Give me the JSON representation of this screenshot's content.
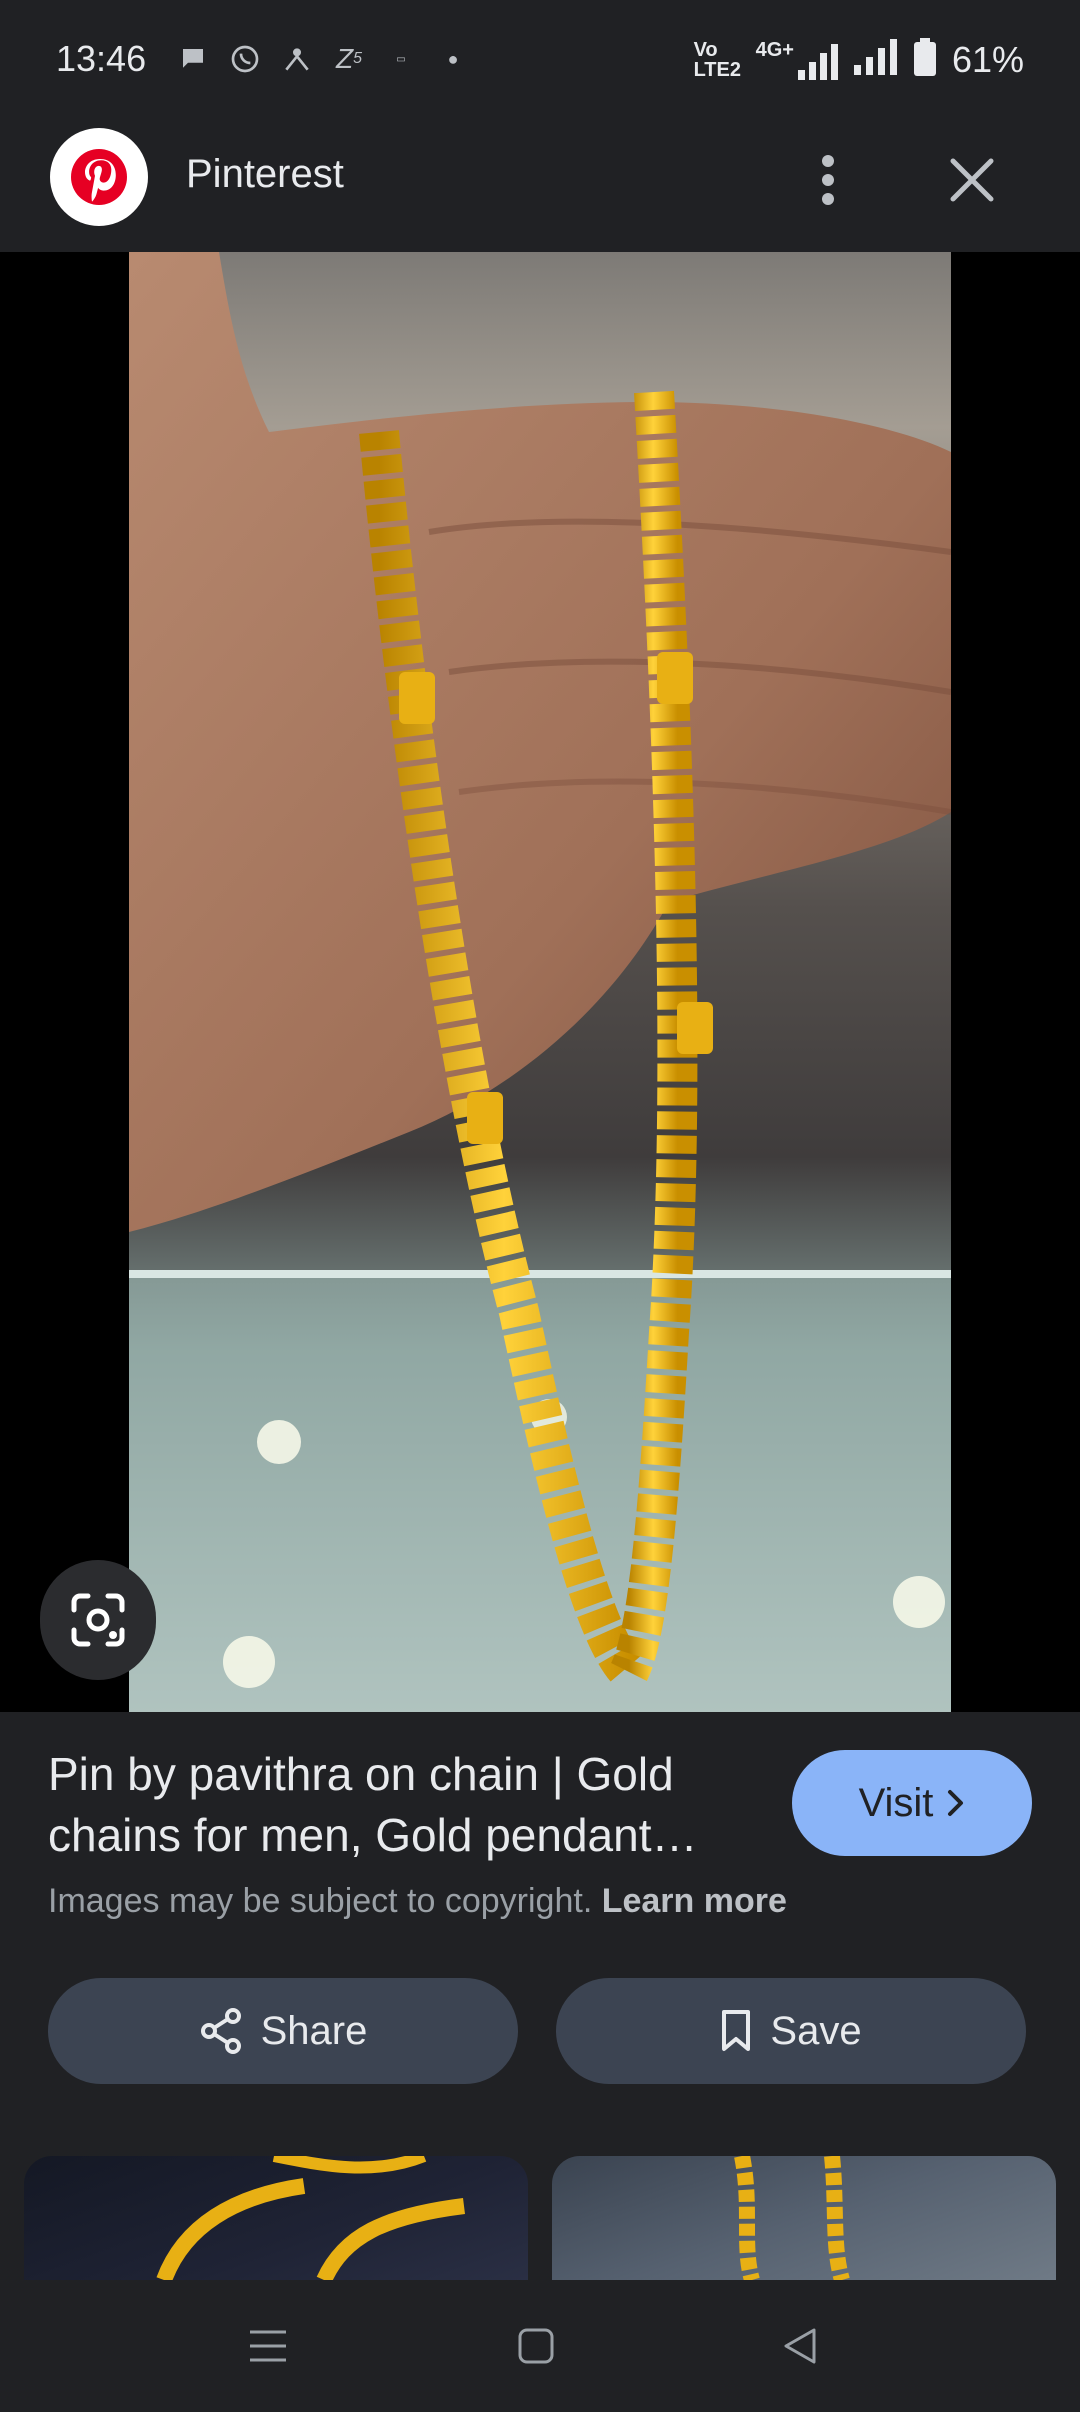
{
  "status_bar": {
    "time": "13:46",
    "network_label": "Vo LTE2",
    "network_type": "4G+",
    "battery": "61%",
    "icons": [
      "chat-icon",
      "whatsapp-icon",
      "network-icon",
      "z5-icon",
      "app-icon",
      "dot-icon"
    ]
  },
  "app_bar": {
    "title": "Pinterest",
    "logo_icon": "pinterest-logo",
    "menu_icon": "more-vert-icon",
    "close_icon": "close-icon"
  },
  "pin": {
    "title": "Pin by pavithra on chain | Gold chains for men, Gold pendant…",
    "visit_label": "Visit",
    "copyright_text": "Images may be subject to copyright.",
    "learn_more": "Learn more"
  },
  "actions": {
    "share_label": "Share",
    "save_label": "Save"
  },
  "colors": {
    "background": "#202124",
    "visit_button": "#8ab4f8",
    "action_button": "#3c4452",
    "gold": "#e8b014"
  }
}
